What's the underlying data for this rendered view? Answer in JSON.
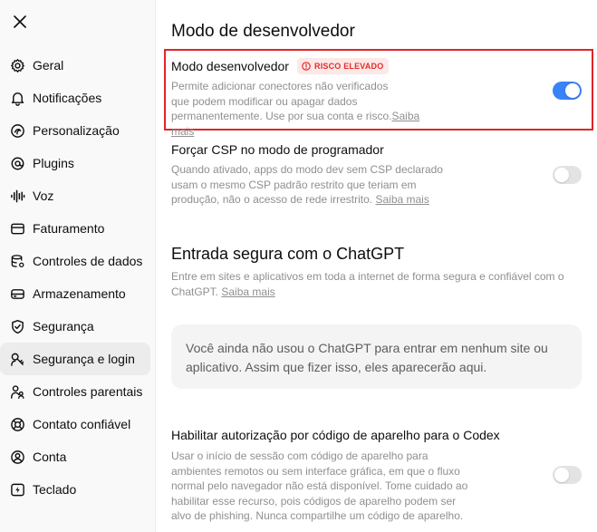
{
  "sidebar": {
    "close_icon": "close-icon",
    "items": [
      {
        "label": "Geral",
        "icon": "gear-icon"
      },
      {
        "label": "Notificações",
        "icon": "bell-icon"
      },
      {
        "label": "Personalização",
        "icon": "personalization-icon"
      },
      {
        "label": "Plugins",
        "icon": "plugins-icon"
      },
      {
        "label": "Voz",
        "icon": "waveform-icon"
      },
      {
        "label": "Faturamento",
        "icon": "card-icon"
      },
      {
        "label": "Controles de dados",
        "icon": "database-icon"
      },
      {
        "label": "Armazenamento",
        "icon": "storage-icon"
      },
      {
        "label": "Segurança",
        "icon": "shield-icon"
      },
      {
        "label": "Segurança e login",
        "icon": "login-icon"
      },
      {
        "label": "Controles parentais",
        "icon": "parental-icon"
      },
      {
        "label": "Contato confiável",
        "icon": "lifebuoy-icon"
      },
      {
        "label": "Conta",
        "icon": "account-icon"
      },
      {
        "label": "Teclado",
        "icon": "keyboard-icon"
      }
    ],
    "active_item": "Segurança e login"
  },
  "main": {
    "section_title": "Modo de desenvolvedor",
    "dev_mode": {
      "title": "Modo desenvolvedor",
      "badge": "RISCO ELEVADO",
      "desc_line1": "Permite adicionar conectores não verificados",
      "desc_line2": "que podem modificar ou apagar dados",
      "desc_line3": "permanentemente. Use por sua conta e risco.",
      "link": "Saiba mais",
      "enabled": true
    },
    "csp": {
      "title": "Forçar CSP no modo de programador",
      "desc_line1": "Quando ativado, apps do modo dev sem CSP declarado",
      "desc_line2": "usam o mesmo CSP padrão restrito que teriam em",
      "desc_line3": "produção, não o acesso de rede irrestrito.",
      "link": "Saiba mais",
      "enabled": false
    },
    "chatgpt_login": {
      "title": "Entrada segura com o ChatGPT",
      "desc_line1": "Entre em sites e aplicativos em toda a internet de forma segura e confiável com o",
      "desc_line2": "ChatGPT.",
      "link": "Saiba mais",
      "empty_line1": "Você ainda não usou o ChatGPT para entrar em nenhum site ou",
      "empty_line2": "aplicativo. Assim que fizer isso, eles aparecerão aqui."
    },
    "codex": {
      "title": "Habilitar autorização por código de aparelho para o Codex",
      "desc_line1": "Usar o início de sessão com código de aparelho para",
      "desc_line2": "ambientes remotos ou sem interface gráfica, em que o fluxo",
      "desc_line3": "normal pelo navegador não está disponível. Tome cuidado ao",
      "desc_line4": "habilitar esse recurso, pois códigos de aparelho podem ser",
      "desc_line5": "alvo de phishing. Nunca compartilhe um código de aparelho.",
      "enabled": false
    }
  },
  "colors": {
    "accent": "#3a82f7",
    "danger": "#e0242a",
    "badge_bg": "#fde8e8"
  }
}
